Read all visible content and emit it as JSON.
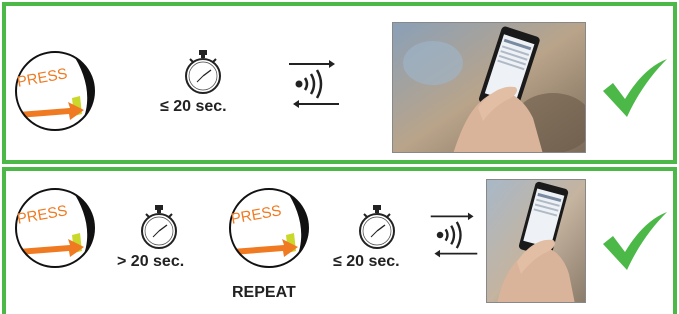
{
  "row1": {
    "press_label": "PRESS",
    "timer_text": "≤ 20 sec."
  },
  "row2": {
    "press1_label": "PRESS",
    "timer1_text": "> 20 sec.",
    "press2_label": "PRESS",
    "repeat_text": "REPEAT",
    "timer2_text": "≤ 20 sec."
  },
  "colors": {
    "border_green": "#4cb848",
    "check_green": "#4cb848",
    "arrow_orange": "#f07a21",
    "button_yellow_green": "#c9d82a"
  },
  "icons": [
    "press-button-icon",
    "stopwatch-icon",
    "nfc-signal-icon",
    "phone-photo",
    "checkmark-icon"
  ]
}
